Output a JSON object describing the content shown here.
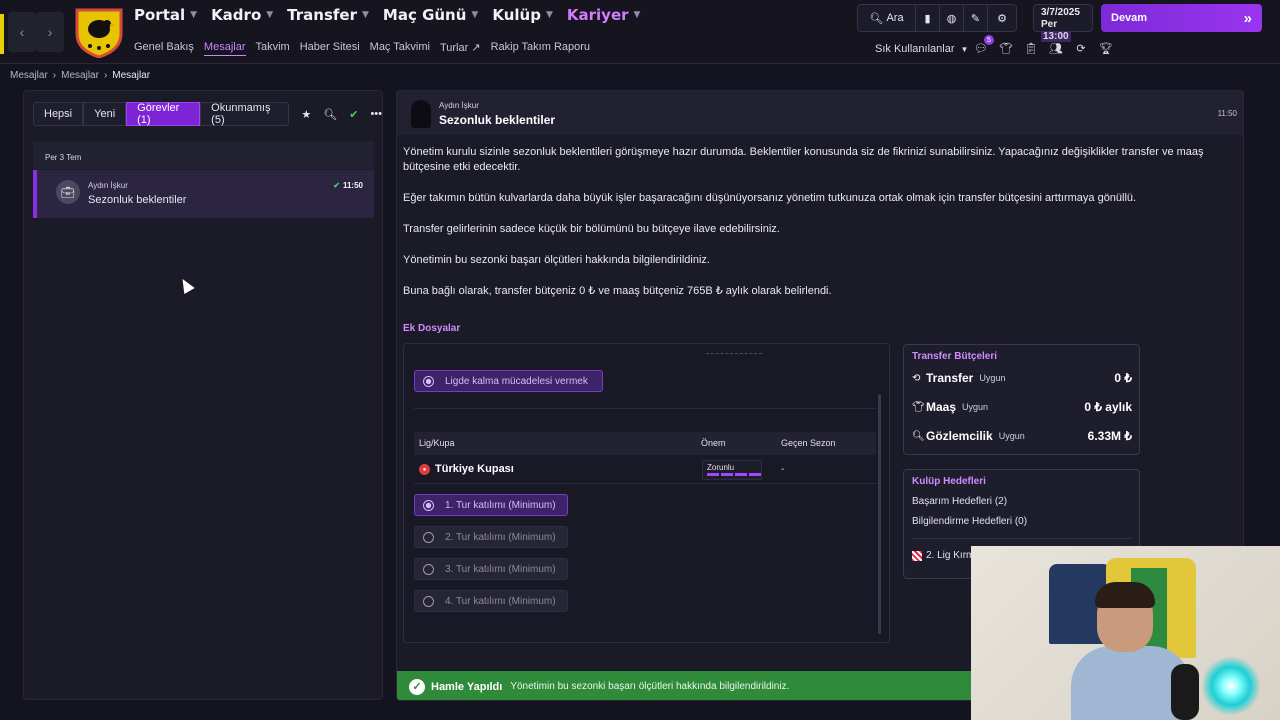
{
  "nav": {
    "back": "‹",
    "forward": "›"
  },
  "mainmenu": [
    {
      "label": "Portal"
    },
    {
      "label": "Kadro"
    },
    {
      "label": "Transfer"
    },
    {
      "label": "Maç Günü"
    },
    {
      "label": "Kulüp"
    },
    {
      "label": "Kariyer"
    }
  ],
  "submenu": [
    "Genel Bakış",
    "Mesajlar",
    "Takvim",
    "Haber Sitesi",
    "Maç Takvimi",
    "Turlar",
    "Rakip Takım Raporu"
  ],
  "toolbar": {
    "search_label": "Ara"
  },
  "date": {
    "line1": "3/7/2025",
    "day": "Per",
    "time": "13:00"
  },
  "continue_label": "Devam",
  "frequent_label": "Sık Kullanılanlar",
  "notif_count": "5",
  "breadcrumb": [
    "Mesajlar",
    "Mesajlar",
    "Mesajlar"
  ],
  "filters": [
    "Hepsi",
    "Yeni",
    "Görevler (1)",
    "Okunmamış (5)"
  ],
  "list": {
    "date_header": "Per 3 Tem",
    "item": {
      "from": "Aydın İşkur",
      "subject": "Sezonluk beklentiler",
      "time": "11:50"
    }
  },
  "message": {
    "from": "Aydın İşkur",
    "title": "Sezonluk beklentiler",
    "time": "11:50",
    "paragraphs": [
      "Yönetim kurulu sizinle sezonluk beklentileri görüşmeye hazır durumda. Beklentiler konusunda siz de fikrinizi sunabilirsiniz. Yapacağınız değişiklikler transfer ve maaş bütçesine etki edecektir.",
      "Eğer takımın bütün kulvarlarda daha büyük işler başaracağını düşünüyorsanız yönetim tutkunuza ortak olmak için transfer bütçesini arttırmaya gönüllü.",
      "Transfer gelirlerinin sadece küçük bir bölümünü bu bütçeye ilave edebilirsiniz.",
      "Yönetimin bu sezonki başarı ölçütleri hakkında bilgilendirildiniz.",
      "Buna bağlı olarak, transfer bütçeniz 0 ₺ ve maaş bütçeniz 765B ₺ aylık olarak belirlendi."
    ]
  },
  "attachments": {
    "header": "Ek Dosyalar",
    "league_goal": "Ligde kalma mücadelesi vermek",
    "table_headers": [
      "Lig/Kupa",
      "Önem",
      "Geçen Sezon"
    ],
    "cup_name": "Türkiye Kupası",
    "importance": "Zorunlu",
    "last_season": "-",
    "rounds": [
      "1. Tur katılımı (Minimum)",
      "2. Tur katılımı (Minimum)",
      "3. Tur katılımı (Minimum)",
      "4. Tur katılımı (Minimum)"
    ]
  },
  "budgets": {
    "header": "Transfer Bütçeleri",
    "rows": [
      {
        "label": "Transfer",
        "status": "Uygun",
        "value": "0 ₺"
      },
      {
        "label": "Maaş",
        "status": "Uygun",
        "value": "0 ₺ aylık"
      },
      {
        "label": "Gözlemcilik",
        "status": "Uygun",
        "value": "6.33M ₺"
      }
    ]
  },
  "goals": {
    "header": "Kulüp Hedefleri",
    "success": "Başarım Hedefleri",
    "success_count": "(2)",
    "info": "Bilgilendirme Hedefleri",
    "info_count": "(0)",
    "league": "2. Lig Kırm"
  },
  "toast": {
    "title": "Hamle Yapıldı",
    "text": "Yönetimin bu sezonki başarı ölçütleri hakkında bilgilendirildiniz."
  },
  "colors": {
    "accent": "#7c24d6",
    "success": "#2f8a3a",
    "title_purple": "#cf8bff"
  }
}
